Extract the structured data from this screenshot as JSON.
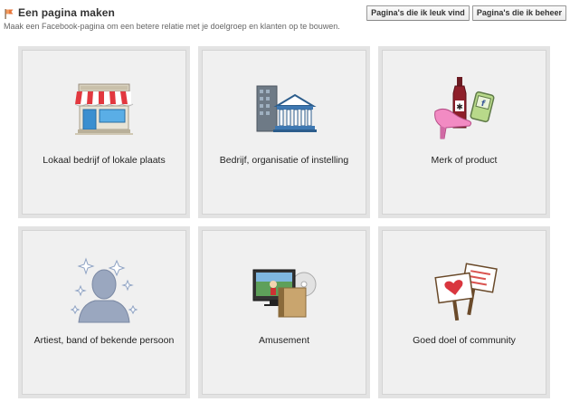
{
  "header": {
    "title": "Een pagina maken",
    "subtitle": "Maak een Facebook-pagina om een betere relatie met je doelgroep en klanten op te bouwen.",
    "buttons": [
      {
        "label": "Pagina's die ik leuk vind"
      },
      {
        "label": "Pagina's die ik beheer"
      }
    ]
  },
  "categories": [
    {
      "label": "Lokaal bedrijf of lokale plaats",
      "icon": "storefront-icon"
    },
    {
      "label": "Bedrijf, organisatie of instelling",
      "icon": "office-building-icon"
    },
    {
      "label": "Merk of product",
      "icon": "product-icon"
    },
    {
      "label": "Artiest, band of bekende persoon",
      "icon": "celebrity-icon"
    },
    {
      "label": "Amusement",
      "icon": "entertainment-icon"
    },
    {
      "label": "Goed doel of community",
      "icon": "cause-signs-icon"
    }
  ],
  "colors": {
    "tile_background": "#f0f0f0",
    "tile_border": "#e3e3e3",
    "flag": "#e8763a"
  }
}
